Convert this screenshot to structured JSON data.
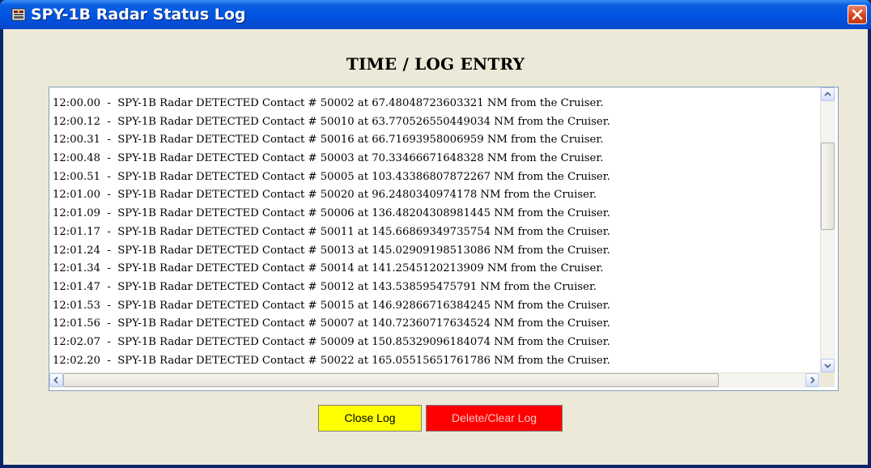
{
  "window": {
    "title": "SPY-1B Radar Status Log",
    "icon": "radar-app-icon",
    "close_icon": "close-x-icon",
    "close_color": "#d6431b",
    "titlebar_color": "#0054e3"
  },
  "log": {
    "heading": "TIME / LOG ENTRY",
    "entries": [
      "12:00.00  -  SPY-1B Radar DETECTED Contact # 50002 at 67.48048723603321 NM from the Cruiser.",
      "12:00.12  -  SPY-1B Radar DETECTED Contact # 50010 at 63.770526550449034 NM from the Cruiser.",
      "12:00.31  -  SPY-1B Radar DETECTED Contact # 50016 at 66.71693958006959 NM from the Cruiser.",
      "12:00.48  -  SPY-1B Radar DETECTED Contact # 50003 at 70.33466671648328 NM from the Cruiser.",
      "12:00.51  -  SPY-1B Radar DETECTED Contact # 50005 at 103.43386807872267 NM from the Cruiser.",
      "12:01.00  -  SPY-1B Radar DETECTED Contact # 50020 at 96.2480340974178 NM from the Cruiser.",
      "12:01.09  -  SPY-1B Radar DETECTED Contact # 50006 at 136.48204308981445 NM from the Cruiser.",
      "12:01.17  -  SPY-1B Radar DETECTED Contact # 50011 at 145.66869349735754 NM from the Cruiser.",
      "12:01.24  -  SPY-1B Radar DETECTED Contact # 50013 at 145.02909198513086 NM from the Cruiser.",
      "12:01.34  -  SPY-1B Radar DETECTED Contact # 50014 at 141.2545120213909 NM from the Cruiser.",
      "12:01.47  -  SPY-1B Radar DETECTED Contact # 50012 at 143.538595475791 NM from the Cruiser.",
      "12:01.53  -  SPY-1B Radar DETECTED Contact # 50015 at 146.92866716384245 NM from the Cruiser.",
      "12:01.56  -  SPY-1B Radar DETECTED Contact # 50007 at 140.72360717634524 NM from the Cruiser.",
      "12:02.07  -  SPY-1B Radar DETECTED Contact # 50009 at 150.85329096184074 NM from the Cruiser.",
      "12:02.20  -  SPY-1B Radar DETECTED Contact # 50022 at 165.05515651761786 NM from the Cruiser."
    ],
    "scroll_icons": [
      "scroll-up-icon",
      "scroll-down-icon",
      "scroll-left-icon",
      "scroll-right-icon"
    ]
  },
  "buttons": {
    "close_label": "Close Log",
    "delete_label": "Delete/Clear Log",
    "close_color": "#ffff00",
    "delete_color": "#ff0000"
  }
}
